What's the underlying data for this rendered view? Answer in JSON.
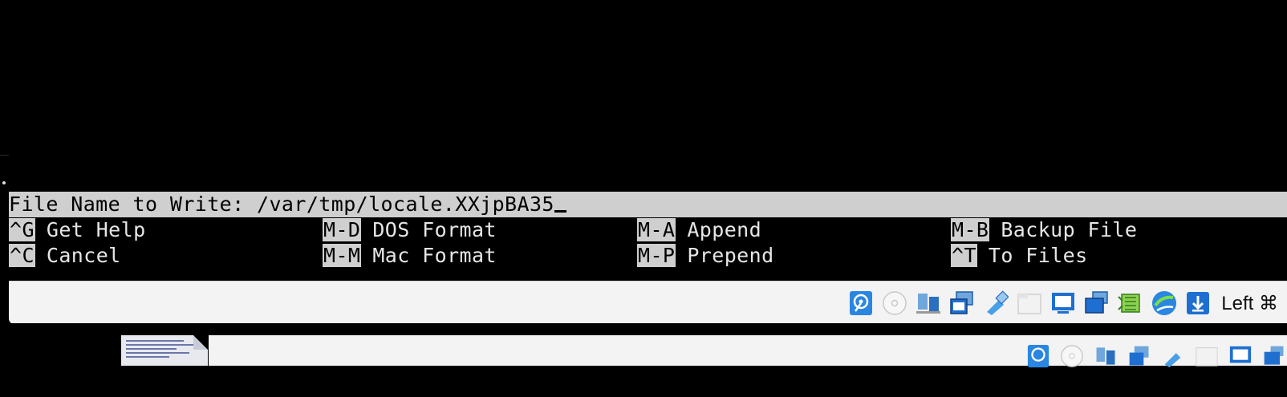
{
  "editor": {
    "prompt_label": "File Name to Write: ",
    "prompt_value": "/var/tmp/locale.XXjpBA35",
    "shortcuts_row1": [
      {
        "key": "^G",
        "label": "Get Help"
      },
      {
        "key": "M-D",
        "label": "DOS Format"
      },
      {
        "key": "M-A",
        "label": "Append"
      },
      {
        "key": "M-B",
        "label": "Backup File"
      }
    ],
    "shortcuts_row2": [
      {
        "key": "^C",
        "label": "Cancel"
      },
      {
        "key": "M-M",
        "label": "Mac Format"
      },
      {
        "key": "M-P",
        "label": "Prepend"
      },
      {
        "key": "^T",
        "label": "To Files"
      }
    ]
  },
  "statusbar": {
    "host_key": "Left ⌘",
    "icons": [
      "hard-disk-icon",
      "optical-drive-icon",
      "audio-icon",
      "network-icon",
      "usb-icon",
      "shared-folder-icon",
      "display-icon",
      "capture-icon",
      "cpu-icon",
      "recording-icon",
      "download-icon"
    ]
  },
  "colors": {
    "terminal_bg": "#000000",
    "terminal_fg": "#e6e6e6",
    "highlight_bg": "#cfcfcf",
    "statusbar_bg": "#f3f3f3",
    "accent_blue": "#1f6fd1",
    "accent_green": "#3fa21f"
  }
}
